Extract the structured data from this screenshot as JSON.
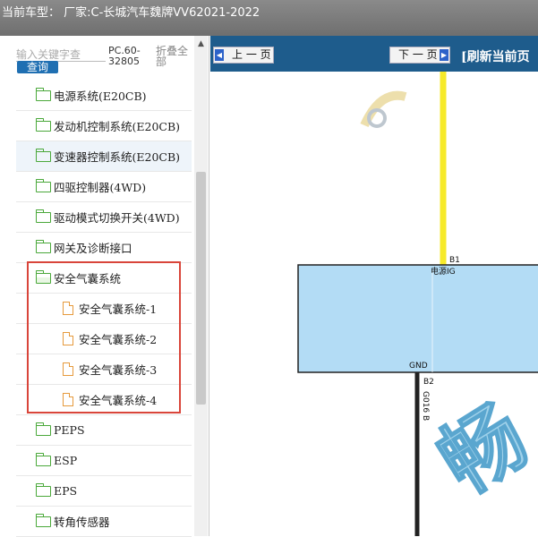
{
  "titlebar": {
    "text": "当前车型： 厂家:C-长城汽车魏牌VV62021-2022"
  },
  "left": {
    "search_placeholder": "输入关键字查",
    "query_label": "查询",
    "pc_number": "PC.60-32805",
    "collapse_label": "折叠全部"
  },
  "tree": {
    "items": [
      {
        "label": "电源系统(E20CB)",
        "level": 1,
        "icon": "folder-icon"
      },
      {
        "label": "发动机控制系统(E20CB)",
        "level": 1,
        "icon": "folder-icon"
      },
      {
        "label": "变速器控制系统(E20CB)",
        "level": 1,
        "icon": "folder-icon"
      },
      {
        "label": "四驱控制器(4WD)",
        "level": 1,
        "icon": "folder-icon"
      },
      {
        "label": "驱动模式切换开关(4WD)",
        "level": 1,
        "icon": "folder-icon"
      },
      {
        "label": "网关及诊断接口",
        "level": 1,
        "icon": "folder-icon"
      },
      {
        "label": "安全气囊系统",
        "level": 1,
        "icon": "folder-open-icon"
      },
      {
        "label": "安全气囊系统-1",
        "level": 2,
        "icon": "document-icon"
      },
      {
        "label": "安全气囊系统-2",
        "level": 2,
        "icon": "document-icon"
      },
      {
        "label": "安全气囊系统-3",
        "level": 2,
        "icon": "document-icon"
      },
      {
        "label": "安全气囊系统-4",
        "level": 2,
        "icon": "document-icon"
      },
      {
        "label": "PEPS",
        "level": 1,
        "icon": "folder-icon"
      },
      {
        "label": "ESP",
        "level": 1,
        "icon": "folder-icon"
      },
      {
        "label": "EPS",
        "level": 1,
        "icon": "folder-icon"
      },
      {
        "label": "转角传感器",
        "level": 1,
        "icon": "folder-icon"
      }
    ]
  },
  "toolbar": {
    "prev_label": "上 一 页",
    "next_label": "下 一 页",
    "refresh_label": "[刷新当前页"
  },
  "diagram": {
    "pin_top_id": "B1",
    "pin_top_name": "电源IG",
    "pin_bottom_name": "GND",
    "pin_bottom_id": "B2",
    "wire_label": "G016 B",
    "watermark_glyph": "畅",
    "wire_top_color": "#f6ea2a",
    "box_color": "#b3dcf5",
    "wire_bottom_color": "#222222"
  },
  "colors": {
    "toolbar_bg": "#1e5c8c",
    "highlight_border": "#d9453a",
    "folder_icon": "#4aa83a",
    "document_icon": "#e69a3c"
  }
}
